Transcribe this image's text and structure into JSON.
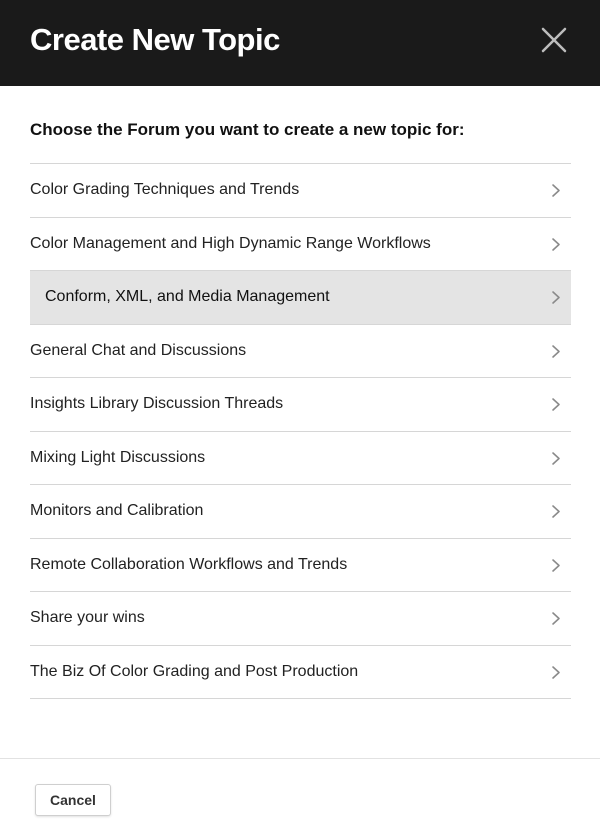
{
  "dialog": {
    "title": "Create New Topic",
    "close_icon": "close-icon",
    "prompt": "Choose the Forum you want to create a new topic for:",
    "forums": [
      {
        "label": "Color Grading Techniques and Trends"
      },
      {
        "label": "Color Management and High Dynamic Range Workflows"
      },
      {
        "label": "Conform, XML, and Media Management",
        "highlighted": true
      },
      {
        "label": "General Chat and Discussions"
      },
      {
        "label": "Insights Library Discussion Threads"
      },
      {
        "label": "Mixing Light Discussions"
      },
      {
        "label": "Monitors and Calibration"
      },
      {
        "label": "Remote Collaboration Workflows and Trends"
      },
      {
        "label": "Share your wins"
      },
      {
        "label": "The Biz Of Color Grading and Post Production"
      }
    ],
    "item_icon": "chevron-right-icon",
    "cancel_label": "Cancel"
  },
  "colors": {
    "header_background": "#1a1a1a",
    "highlight_background": "#e4e4e4",
    "divider": "#d6d6d6"
  }
}
